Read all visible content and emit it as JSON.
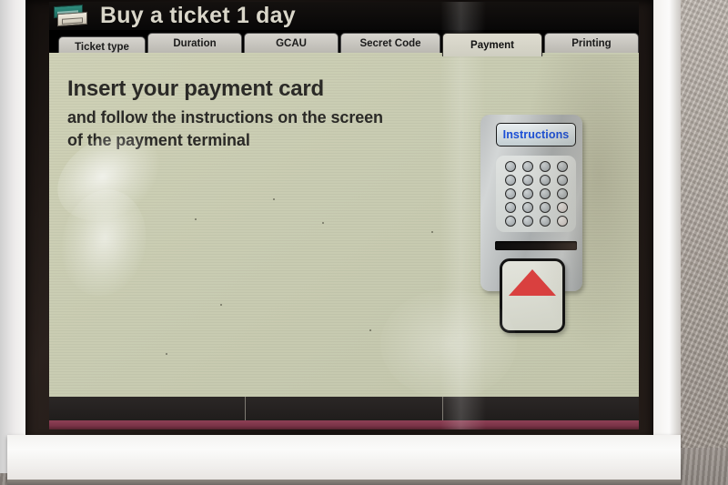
{
  "window": {
    "title": "Buy a ticket 1 day",
    "ticket_icon": "ticket-stack-icon"
  },
  "tabs": [
    {
      "label": "Ticket type",
      "active": false
    },
    {
      "label": "Duration",
      "active": false
    },
    {
      "label": "GCAU",
      "active": false
    },
    {
      "label": "Secret Code",
      "active": false
    },
    {
      "label": "Payment",
      "active": true
    },
    {
      "label": "Printing",
      "active": false
    }
  ],
  "content": {
    "headline": "Insert your payment card",
    "subline_1": "and follow the instructions on the screen",
    "subline_2": "of the payment terminal"
  },
  "terminal": {
    "display_label": "Instructions",
    "keypad_rows": 5,
    "keypad_cols": 4,
    "card_arrow": "up-arrow-red",
    "slot": "card-slot"
  },
  "softkeys": [
    {
      "label": ""
    },
    {
      "label": ""
    },
    {
      "label": ""
    }
  ],
  "colors": {
    "screen_background": "#c9ccb2",
    "titlebar": "#0b0a09",
    "title_text": "#d9d6c9",
    "tab_inactive": "#c7c5be",
    "tab_active": "#d6d4c8",
    "instructions_text": "#1b4fd6",
    "arrow_red": "#d9403f",
    "accent_bar": "#7a3347",
    "body_text": "#2b2a27"
  }
}
